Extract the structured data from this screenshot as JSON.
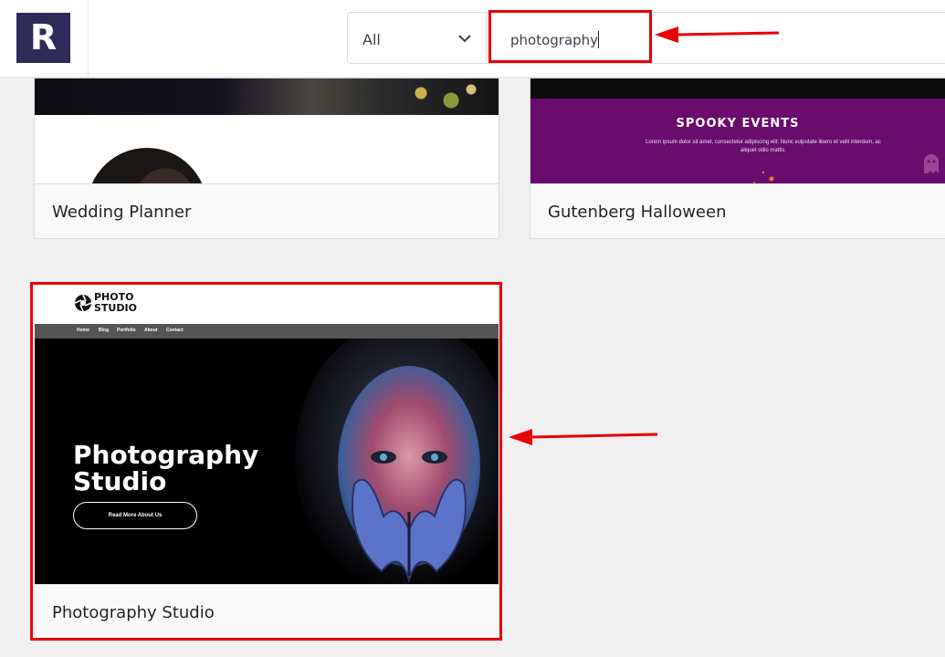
{
  "header": {
    "logo_letter": "R",
    "filter": {
      "selected": "All"
    },
    "search": {
      "value": "photography"
    }
  },
  "templates": [
    {
      "name": "Wedding Planner"
    },
    {
      "name": "Gutenberg Halloween",
      "preview": {
        "heading": "SPOOKY EVENTS",
        "text": "Lorem ipsum dolor sit amet, consectetur adipiscing elit. Nunc vulputate libero et velit interdum, ac aliquet odio mattis."
      }
    },
    {
      "name": "Photography Studio",
      "preview": {
        "logo_line1": "PHOTO",
        "logo_line2": "STUDIO",
        "nav": [
          "Home",
          "Blog",
          "Portfolio",
          "About",
          "Contact"
        ],
        "hero_line1": "Photography",
        "hero_line2": "Studio",
        "button": "Read More About Us"
      }
    }
  ],
  "annotations": {
    "highlight_color": "#e80000"
  }
}
